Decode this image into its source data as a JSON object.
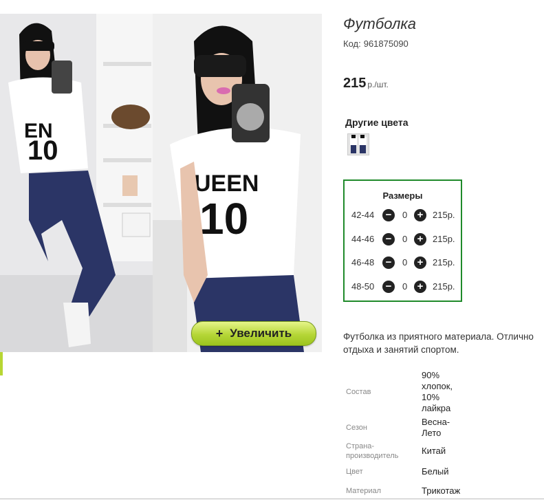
{
  "product": {
    "title": "Футболка",
    "code_label": "Код:",
    "code": "961875090",
    "price": "215",
    "price_unit": "р./шт."
  },
  "gallery": {
    "zoom_label": "Увеличить",
    "zoom_icon": "+"
  },
  "other_colors": {
    "title": "Другие цвета"
  },
  "sizes": {
    "title": "Размеры",
    "rows": [
      {
        "size": "42-44",
        "qty": "0",
        "price": "215р."
      },
      {
        "size": "44-46",
        "qty": "0",
        "price": "215р."
      },
      {
        "size": "46-48",
        "qty": "0",
        "price": "215р."
      },
      {
        "size": "48-50",
        "qty": "0",
        "price": "215р."
      }
    ]
  },
  "description": {
    "line1": "Футболка из приятного материала. Отлично",
    "line2": "отдыха и занятий спортом."
  },
  "properties": [
    {
      "label": "Состав",
      "value": "90%\nхлопок,\n10%\nлайкра"
    },
    {
      "label": "Сезон",
      "value": "Весна-\nЛето"
    },
    {
      "label": "Страна-\nпроизводитель",
      "value": "Китай"
    },
    {
      "label": "Цвет",
      "value": "Белый"
    },
    {
      "label": "Материал",
      "value": "Трикотаж"
    }
  ],
  "colors": {
    "frame_green": "#1f8a2a",
    "button_green": "#b5d637",
    "jeans": "#2b3566"
  }
}
